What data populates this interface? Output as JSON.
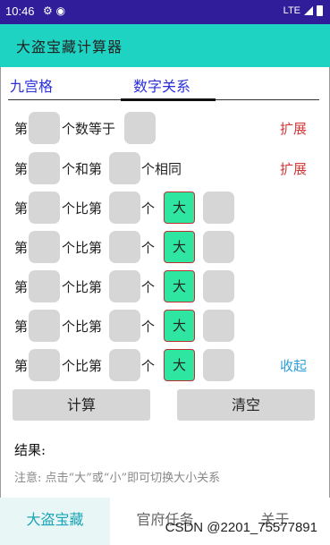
{
  "statusbar": {
    "time": "10:46",
    "network": "LTE"
  },
  "appbar": {
    "title": "大盗宝藏计算器"
  },
  "tabs": [
    {
      "label": "九宫格",
      "active": false
    },
    {
      "label": "数字关系",
      "active": true
    }
  ],
  "row1": {
    "prefix": "第",
    "mid": "个数等于",
    "expand": "扩展"
  },
  "row2": {
    "prefix": "第",
    "mid": "个和第",
    "suffix": "个相同",
    "expand": "扩展"
  },
  "compare_rows": [
    {
      "prefix": "第",
      "mid": "个比第",
      "suffix": "个",
      "toggle": "大"
    },
    {
      "prefix": "第",
      "mid": "个比第",
      "suffix": "个",
      "toggle": "大"
    },
    {
      "prefix": "第",
      "mid": "个比第",
      "suffix": "个",
      "toggle": "大"
    },
    {
      "prefix": "第",
      "mid": "个比第",
      "suffix": "个",
      "toggle": "大"
    },
    {
      "prefix": "第",
      "mid": "个比第",
      "suffix": "个",
      "toggle": "大"
    }
  ],
  "collapse_label": "收起",
  "buttons": {
    "calculate": "计算",
    "clear": "清空"
  },
  "result_label": "结果:",
  "note": "注意: 点击“大”或“小”即可切换大小关系",
  "bottom_nav": [
    {
      "label": "大盗宝藏",
      "active": true
    },
    {
      "label": "官府任务",
      "active": false
    },
    {
      "label": "关于",
      "active": false
    }
  ],
  "watermark": "CSDN @2201_75577891",
  "colors": {
    "accent": "#1fd3c3",
    "statusbar": "#2f1d9a",
    "toggle": "#2ee6a0",
    "link_red": "#d23a3a",
    "link_blue": "#2aa0d8"
  }
}
